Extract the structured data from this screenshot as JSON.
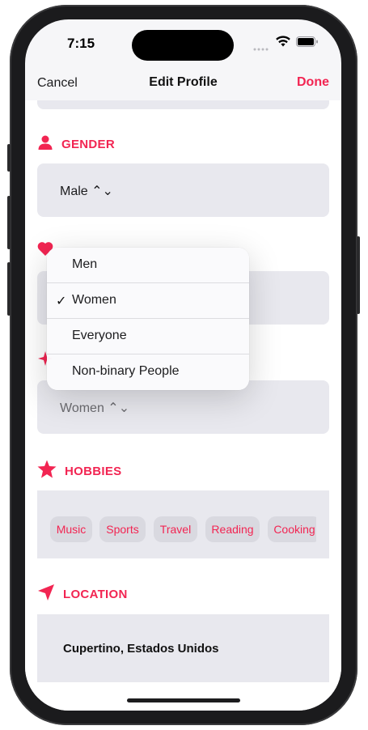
{
  "status_bar": {
    "time": "7:15"
  },
  "nav": {
    "cancel": "Cancel",
    "title": "Edit Profile",
    "done": "Done"
  },
  "sections": {
    "gender": {
      "label": "GENDER",
      "value": "Male ⌃⌄"
    },
    "interested_in": {
      "value": "Women ⌃⌄"
    },
    "hobbies": {
      "label": "HOBBIES",
      "items": [
        "Music",
        "Sports",
        "Travel",
        "Reading",
        "Cooking"
      ]
    },
    "location": {
      "label": "LOCATION",
      "value": "Cupertino, Estados Unidos"
    }
  },
  "menu": {
    "options": [
      "Men",
      "Women",
      "Everyone",
      "Non-binary People"
    ],
    "selected": "Women"
  },
  "colors": {
    "accent": "#f22552",
    "card": "#e8e8ee",
    "chip": "#d9d9e0"
  },
  "icons": {
    "gender": "person-icon",
    "interested_in": "heart-icon",
    "looking_for": "sparkle-icon",
    "hobbies": "star-icon",
    "location": "location-arrow-icon"
  }
}
